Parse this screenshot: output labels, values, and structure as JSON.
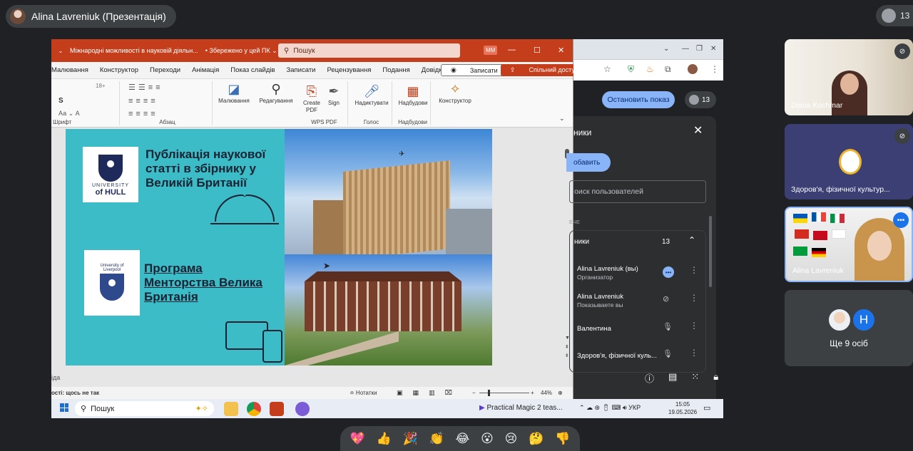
{
  "meet": {
    "presenter_title": "Alina Lavreniuk (Презентація)",
    "participants_badge": "13"
  },
  "ppt": {
    "doc_title": "Міжнародні можливості в науковій діяльн...",
    "saved_status": "• Збережено у цей ПК ⌄",
    "search_placeholder": "Пошук",
    "user_initials": "MM",
    "menu": [
      "Малювання",
      "Конструктор",
      "Переходи",
      "Анімація",
      "Показ слайдів",
      "Записати",
      "Рецензування",
      "Подання",
      "Довідка"
    ],
    "record_btn": "Записати",
    "share_btn": "Спільний доступ ⌄",
    "ribbon": {
      "font_group": "Шрифт",
      "paragraph_group": "Абзац",
      "drawing": "Малювання",
      "editing": "Редагування",
      "create_pdf": "Create PDF",
      "sign": "Sign",
      "wps_group": "WPS PDF",
      "dictate": "Надиктувати",
      "voice_group": "Голос",
      "addins": "Надбудови",
      "addins_group": "Надбудови",
      "designer": "Конструктор",
      "font_size": "18+"
    },
    "slide": {
      "text1": "Публікація наукової статті в збірнику у Великій Британії",
      "text2": "Програма Менторства Велика Британія",
      "hull_logo_line1": "UNIVERSITY",
      "hull_logo_line2": "of HULL",
      "liverpool_logo_line1": "University of Liverpool"
    },
    "notes_label": "іда",
    "status_left": "ості: щось не так",
    "status_notes": "≐ Нотатки",
    "zoom": "44%"
  },
  "chrome": {
    "stop_share": "Остановить показ",
    "people_count": "13"
  },
  "people_panel": {
    "title": "ники",
    "add_btn": "обавить",
    "search_placeholder": "оиск пользователей",
    "in_call_label": "ЕЧЕ",
    "group_title": "ники",
    "group_count": "13",
    "rows": [
      {
        "name": "Alina Lavreniuk (вы)",
        "role": "Организатор"
      },
      {
        "name": "Alina Lavreniuk",
        "role": "Показываете вы"
      },
      {
        "name": "Валентина",
        "role": ""
      },
      {
        "name": "Здоров'я, фізичної куль...",
        "role": ""
      }
    ]
  },
  "taskbar": {
    "search": "Пошук",
    "media": "Practical Magic 2 teas...",
    "lang": "УКР",
    "time": "15:05",
    "date": "19.05.2026"
  },
  "tiles": {
    "t1_name": "Diana Kochmar",
    "t2_name": "Здоров'я, фізичної культур...",
    "t3_name": "Alina Lavreniuk",
    "more_people": "Ще 9 осіб",
    "avatar_letter": "H"
  },
  "reactions": [
    "💖",
    "👍",
    "🎉",
    "👏",
    "😂",
    "😮",
    "😢",
    "🤔",
    "👎"
  ]
}
